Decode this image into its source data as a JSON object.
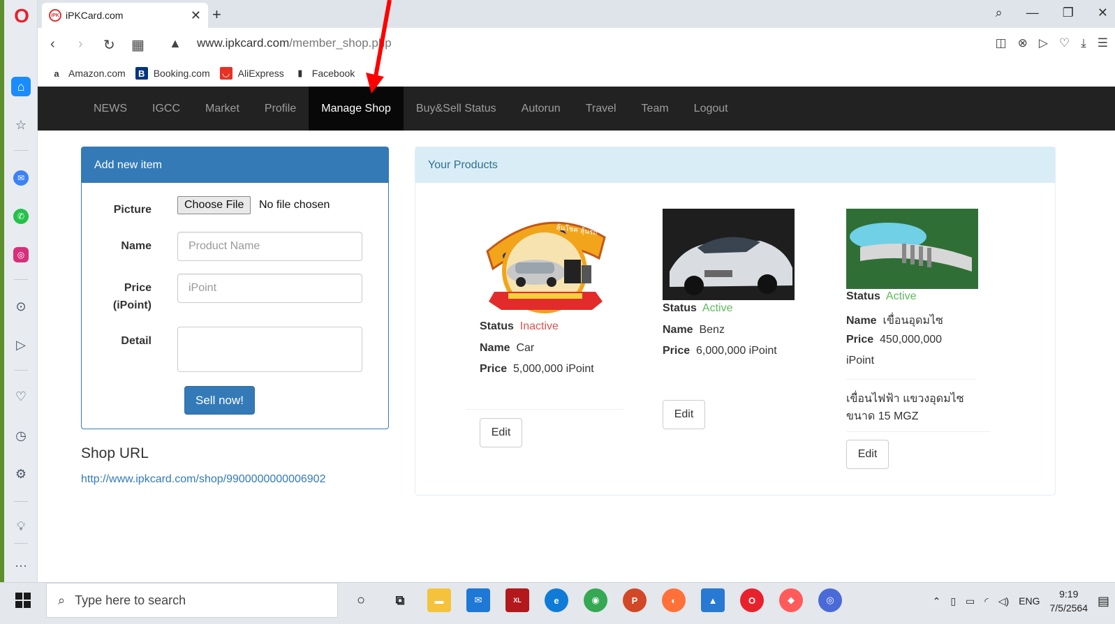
{
  "browser": {
    "tab_title": "iPKCard.com",
    "tab_favicon_text": "iPK",
    "tab_close_glyph": "✕",
    "new_tab_glyph": "+",
    "url_domain": "www.ipkcard.com",
    "url_path": "/member_shop.php",
    "bookmarks": [
      "Amazon.com",
      "Booking.com",
      "AliExpress",
      "Facebook"
    ]
  },
  "nav": {
    "items": [
      "NEWS",
      "IGCC",
      "Market",
      "Profile",
      "Manage Shop",
      "Buy&Sell Status",
      "Autorun",
      "Travel",
      "Team",
      "Logout"
    ],
    "active": "Manage Shop"
  },
  "add_item": {
    "heading": "Add new item",
    "picture_label": "Picture",
    "file_button": "Choose File",
    "file_status": "No file chosen",
    "name_label": "Name",
    "name_placeholder": "Product Name",
    "price_label_1": "Price",
    "price_label_2": "(iPoint)",
    "price_placeholder": "iPoint",
    "detail_label": "Detail",
    "submit": "Sell now!"
  },
  "shop": {
    "title": "Shop URL",
    "url": "http://www.ipkcard.com/shop/9900000000006902"
  },
  "products": {
    "heading": "Your Products",
    "status_key": "Status",
    "name_key": "Name",
    "price_key": "Price",
    "edit_label": "Edit",
    "items": [
      {
        "status": "Inactive",
        "name": "Car",
        "price": "5,000,000 iPoint",
        "badge_text": "ชอปสนุก",
        "badge_sub": "ลุ้นโชค ลุ้นรถ"
      },
      {
        "status": "Active",
        "name": "Benz",
        "price": "6,000,000 iPoint"
      },
      {
        "status": "Active",
        "name": "เขื่อนอุดมไซ",
        "price_line1": "450,000,000",
        "price_line2": "iPoint",
        "detail_line1": "เขื่อนไฟฟ้า แขวงอุดมไซ",
        "detail_line2": "ขนาด 15 MGZ"
      }
    ]
  },
  "taskbar": {
    "search_placeholder": "Type here to search",
    "lang": "ENG",
    "time": "9:19",
    "date": "7/5/2564"
  },
  "colors": {
    "primary": "#337ab7",
    "navbar": "#222222",
    "inactive": "#d9534f",
    "active": "#5cb85c",
    "annotation_arrow": "#ff0000"
  }
}
